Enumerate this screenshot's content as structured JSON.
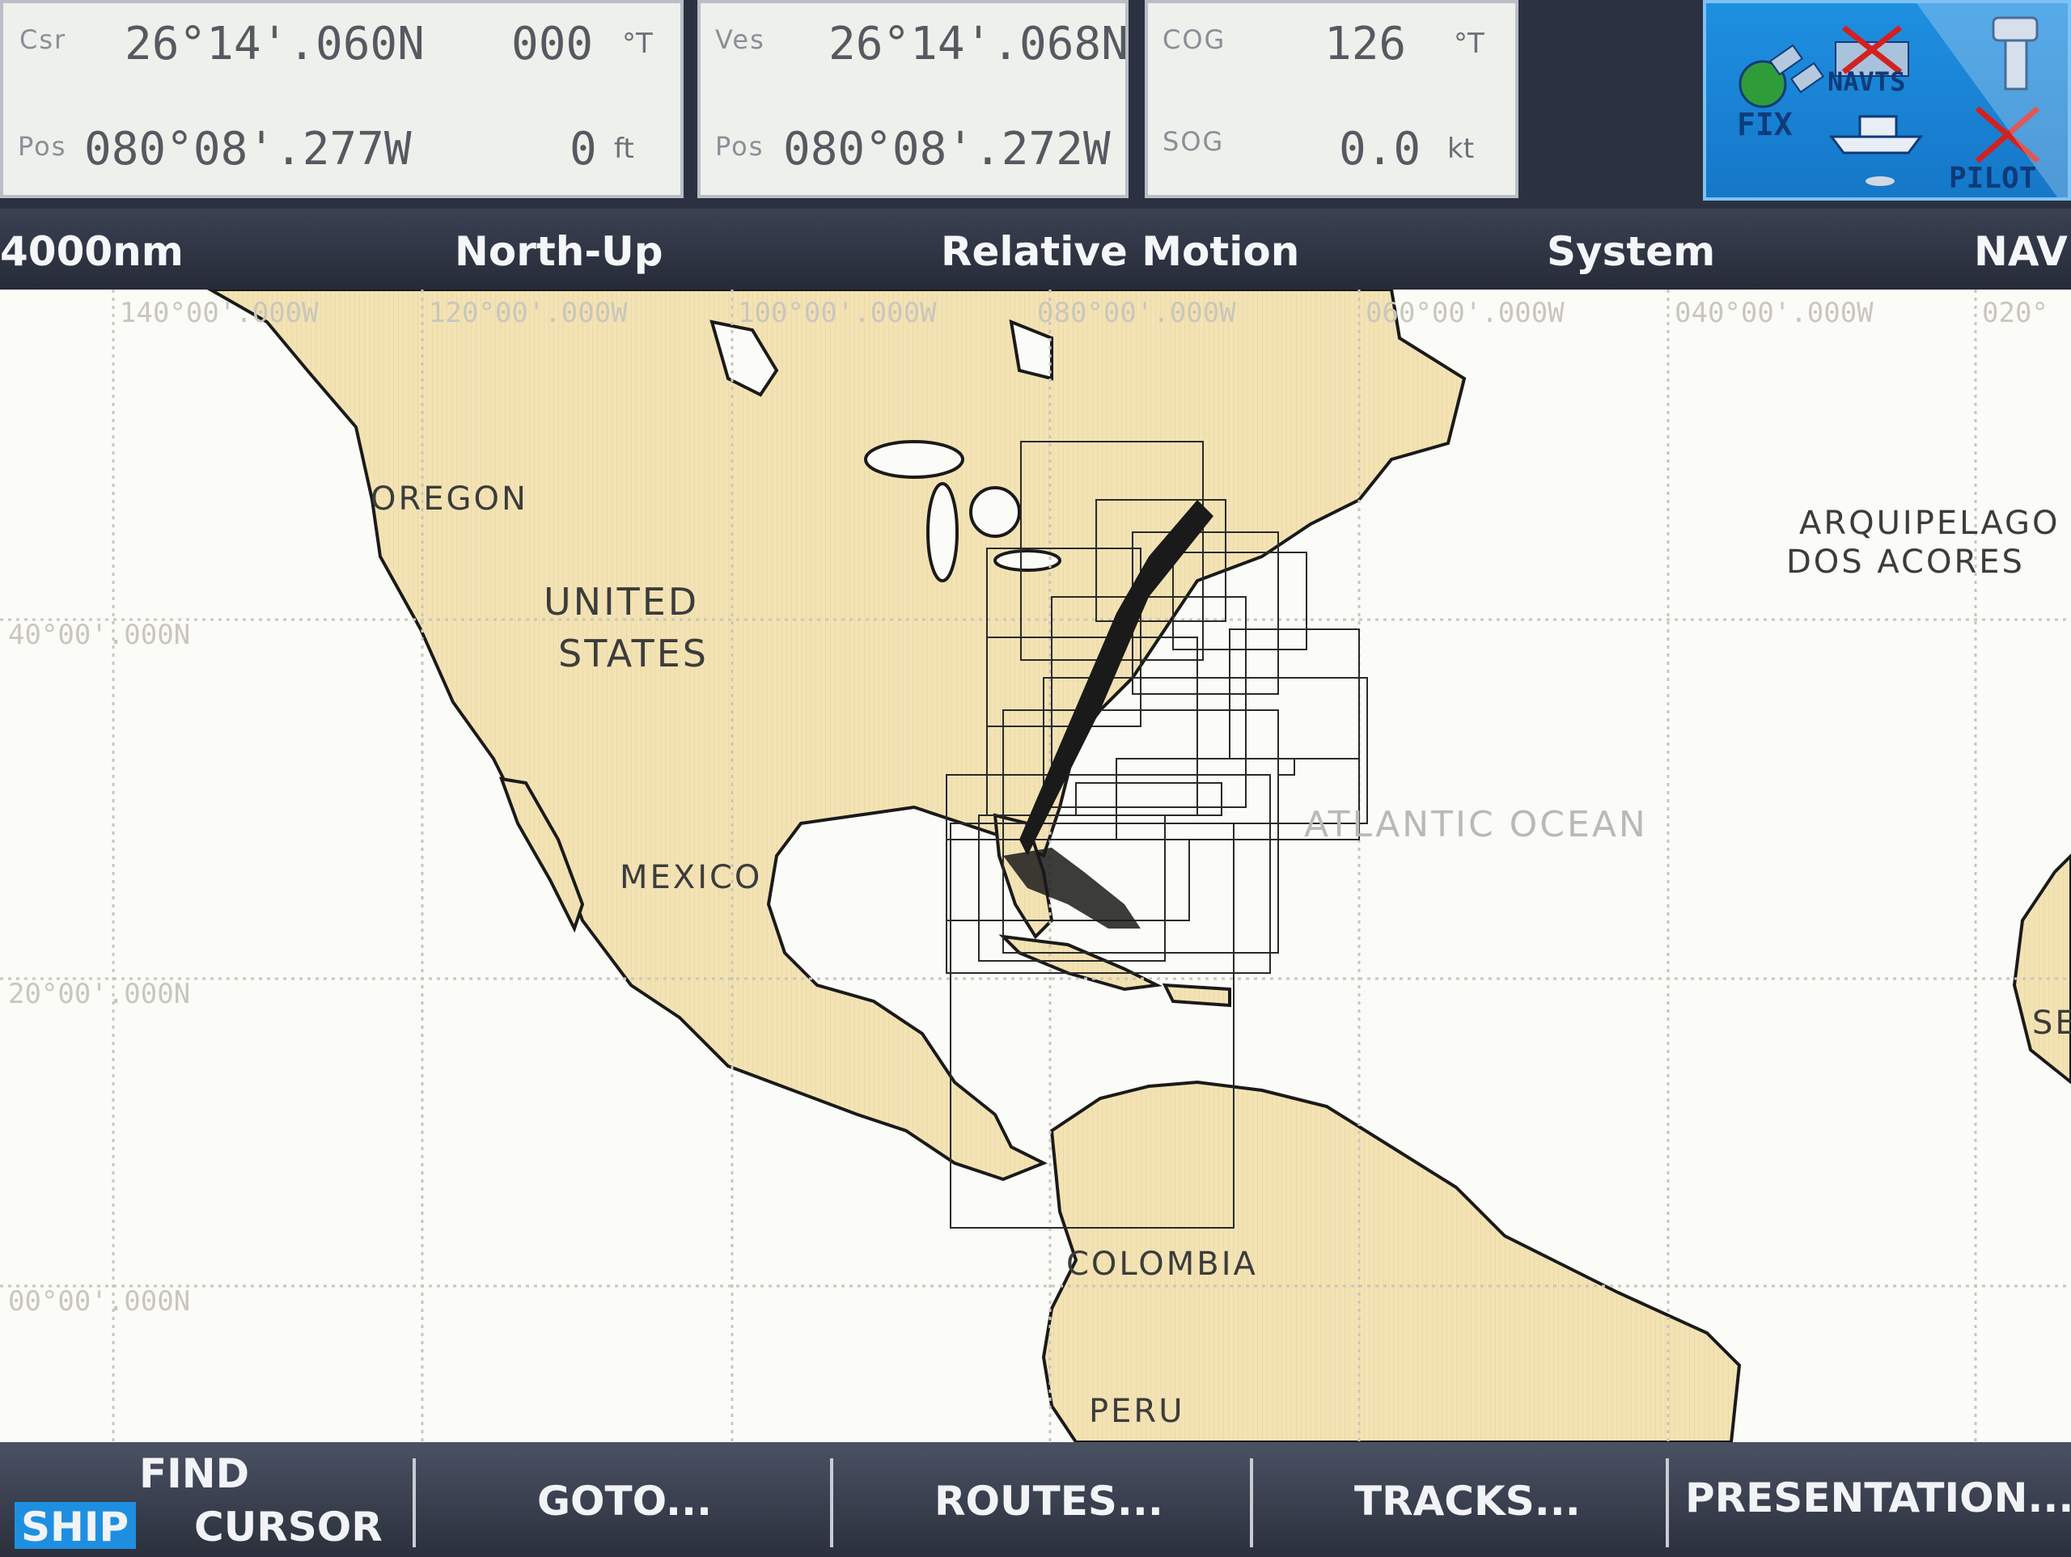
{
  "course_panel": {
    "csr_label": "Csr",
    "csr_lat": "26°14'.060N",
    "csr_heading": "000",
    "csr_heading_unit": "°T",
    "pos_label": "Pos",
    "pos_lon": "080°08'.277W",
    "depth": "0",
    "depth_unit": "ft"
  },
  "vessel_panel": {
    "ves_label": "Ves",
    "ves_lat": "26°14'.068N",
    "pos_label": "Pos",
    "pos_lon": "080°08'.272W"
  },
  "nav_panel": {
    "cog_label": "COG",
    "cog_value": "126",
    "cog_unit": "°T",
    "sog_label": "SOG",
    "sog_value": "0.0",
    "sog_unit": "kt"
  },
  "status_box": {
    "fix_label": "FIX",
    "nav_label": "NAVTS",
    "pilot_label": "PILOT"
  },
  "mode_bar": {
    "range": "4000nm",
    "orientation": "North-Up",
    "motion": "Relative Motion",
    "system": "System",
    "nav": "NAV"
  },
  "chart": {
    "lon_labels": [
      "140°00'.000W",
      "120°00'.000W",
      "100°00'.000W",
      "080°00'.000W",
      "060°00'.000W",
      "040°00'.000W",
      "020°"
    ],
    "lat_labels": [
      "40°00'.000N",
      "20°00'.000N",
      "00°00'.000N"
    ],
    "places": {
      "oregon": "OREGON",
      "united": "UNITED",
      "states": "STATES",
      "mexico": "MEXICO",
      "atlantic": "ATLANTIC OCEAN",
      "azores1": "ARQUIPELAGO",
      "azores2": "DOS ACORES",
      "colombia": "COLOMBIA",
      "peru": "PERU",
      "se": "SE"
    },
    "colors": {
      "land": "#f3e3b4",
      "sea": "#fbfbf7",
      "grid": "#c9c6bd",
      "coast": "#1a1a1a"
    }
  },
  "softkeys": {
    "find": "FIND",
    "ship": "SHIP",
    "cursor": "CURSOR",
    "goto": "GOTO...",
    "routes": "ROUTES...",
    "tracks": "TRACKS...",
    "presentation": "PRESENTATION..."
  }
}
